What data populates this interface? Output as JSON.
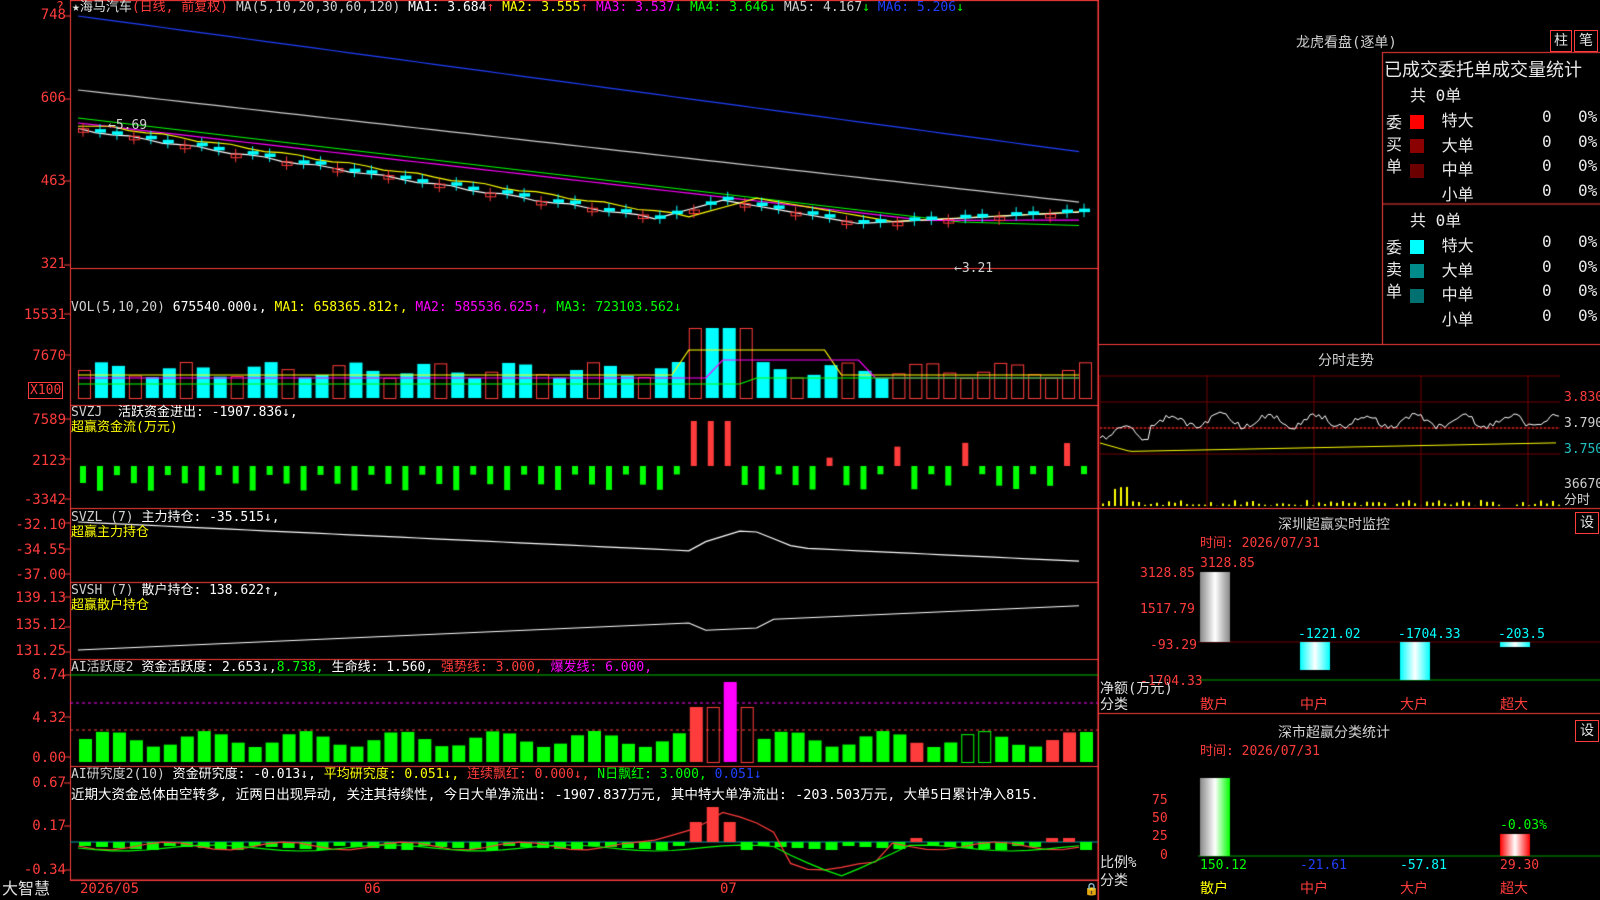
{
  "stock": {
    "title": "★海马汽车",
    "mode": "(日线, 前复权)",
    "ma_label": "MA(5,10,20,30,60,120)",
    "ma": [
      {
        "name": "MA1:",
        "value": "3.684",
        "arrow": "↑",
        "color": "#ffffff"
      },
      {
        "name": "MA2:",
        "value": "3.555",
        "arrow": "↑",
        "color": "#ffff00"
      },
      {
        "name": "MA3:",
        "value": "3.537",
        "arrow": "↓",
        "color": "#ff00ff"
      },
      {
        "name": "MA4:",
        "value": "3.646",
        "arrow": "↓",
        "color": "#00ff00"
      },
      {
        "name": "MA5:",
        "value": "4.167",
        "arrow": "↓",
        "color": "#cfcfcf"
      },
      {
        "name": "MA6:",
        "value": "5.206",
        "arrow": "↓",
        "color": "#2040ff"
      }
    ],
    "y_ticks": [
      "748",
      "606",
      "463",
      "321"
    ],
    "price_hi_label": "5.69",
    "price_lo_label": "←3.21"
  },
  "vol": {
    "label": "VOL(5,10,20)",
    "value": "675540.000↓,",
    "ma1": "MA1: 658365.812↑,",
    "ma2": "MA2: 585536.625↑,",
    "ma3": "MA3: 723103.562↓",
    "y_ticks": [
      "15531",
      "7670"
    ],
    "unit": "X100"
  },
  "svzj": {
    "label": "SVZJ",
    "text": "活跃资金进出: -1907.836↓,",
    "sub": "超赢资金流(万元)",
    "y_ticks": [
      "7589",
      "2123",
      "-3342"
    ]
  },
  "svzl": {
    "label": "SVZL (7)",
    "text": "主力持仓: -35.515↓,",
    "sub": "超赢主力持仓",
    "y_ticks": [
      "-32.10",
      "-34.55",
      "-37.00"
    ]
  },
  "svsh": {
    "label": "SVSH (7)",
    "text": "散户持仓: 138.622↑,",
    "sub": "超赢散户持仓",
    "y_ticks": [
      "139.13",
      "135.12",
      "131.25"
    ]
  },
  "ai2": {
    "label": "AI活跃度2",
    "t1": "资金活跃度: 2.653↓,",
    "t2": "8.738,",
    "t3": "生命线: 1.560,",
    "t4": "强势线: 3.000,",
    "t5": "爆发线: 6.000,",
    "y_ticks": [
      "8.74",
      "4.32",
      "0.00"
    ]
  },
  "ai3": {
    "label": "AI研究度2(10)",
    "t1": "资金研究度: -0.013↓,",
    "t2": "平均研究度: 0.051↓,",
    "t3": "连续飘红: 0.000↓,",
    "t4": "N日飘红: 3.000,",
    "t5": "0.051↓",
    "comment": "近期大资金总体由空转多, 近两日出现异动, 关注其持续性, 今日大单净流出: -1907.837万元, 其中特大单净流出: -203.503万元, 大单5日累计净入815.",
    "y_ticks": [
      "0.67",
      "0.17",
      "-0.34"
    ]
  },
  "xaxis": {
    "left_label": "大智慧",
    "dates": [
      "2026/05",
      "06",
      "07"
    ]
  },
  "right": {
    "lhb_title": "龙虎看盘(逐单)",
    "btn_bar": "柱",
    "btn_pen": "笔",
    "stat_title": "已成交委托单成交量统计",
    "buy": {
      "label": "委买单",
      "total": "共 0单",
      "rows": [
        {
          "name": "特大",
          "val": "0",
          "pct": "0%",
          "color": "#ff0000"
        },
        {
          "name": "大单",
          "val": "0",
          "pct": "0%",
          "color": "#8b0000"
        },
        {
          "name": "中单",
          "val": "0",
          "pct": "0%",
          "color": "#6b0000"
        },
        {
          "name": "小单",
          "val": "0",
          "pct": "0%",
          "color": ""
        }
      ]
    },
    "sell": {
      "label": "委卖单",
      "total": "共 0单",
      "rows": [
        {
          "name": "特大",
          "val": "0",
          "pct": "0%",
          "color": "#00ffff"
        },
        {
          "name": "大单",
          "val": "0",
          "pct": "0%",
          "color": "#008b8b"
        },
        {
          "name": "中单",
          "val": "0",
          "pct": "0%",
          "color": "#007070"
        },
        {
          "name": "小单",
          "val": "0",
          "pct": "0%",
          "color": ""
        }
      ]
    },
    "intraday_title": "分时走势",
    "intraday_ticks": [
      "3.830",
      "3.790",
      "3.750",
      "36670"
    ],
    "intraday_unit": "分时",
    "monitor": {
      "title": "深圳超赢实时监控",
      "btn": "设",
      "time": "时间: 2026/07/31",
      "y_ticks": [
        "3128.85",
        "1517.79",
        "-93.29",
        "-1704.33"
      ],
      "top_val": "3128.85",
      "bar_labels": [
        "-1221.02",
        "-1704.33",
        "-203.5"
      ],
      "cat_label": "净额(万元)",
      "cat_label2": "分类",
      "cats": [
        "散户",
        "中户",
        "大户",
        "超大"
      ]
    },
    "classify": {
      "title": "深市超赢分类统计",
      "btn": "设",
      "time": "时间: 2026/07/31",
      "y_ticks": [
        "75",
        "50",
        "25",
        "0"
      ],
      "pct_label": "-0.03%",
      "cat_label": "比例%",
      "cat_label2": "分类",
      "vals": [
        "150.12",
        "-21.61",
        "-57.81",
        "29.30"
      ],
      "cats": [
        "散户",
        "中户",
        "大户",
        "超大"
      ]
    }
  }
}
